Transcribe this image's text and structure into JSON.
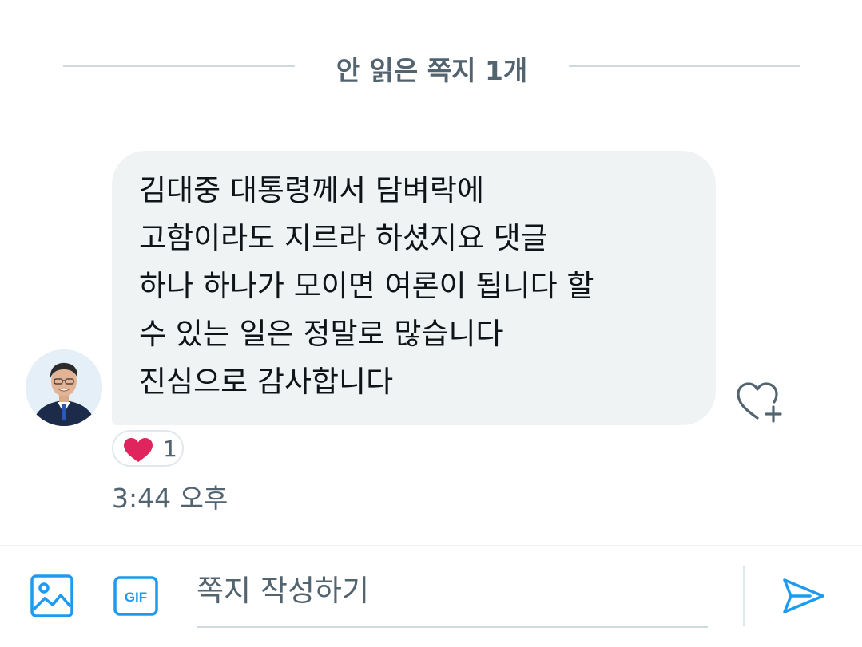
{
  "unread_divider": {
    "label": "안 읽은 쪽지 1개"
  },
  "message": {
    "lines": [
      "김대중 대통령께서 담벼락에",
      "고함이라도 지르라 하셨지요 댓글",
      "하나 하나가 모이면 여론이 됩니다 할",
      "수 있는 일은 정말로 많습니다",
      "진심으로 감사합니다"
    ],
    "reaction_count": "1",
    "timestamp": "3:44 오후"
  },
  "composer": {
    "placeholder": "쪽지 작성하기"
  },
  "icons": {
    "react": "heart-plus-icon",
    "reaction": "heart-icon",
    "media": "image-icon",
    "gif": "gif-icon",
    "send": "send-icon"
  },
  "colors": {
    "accent": "#1d9bf0",
    "bubble": "#eff3f4",
    "heart": "#e0245e",
    "secondary_text": "#536471"
  }
}
